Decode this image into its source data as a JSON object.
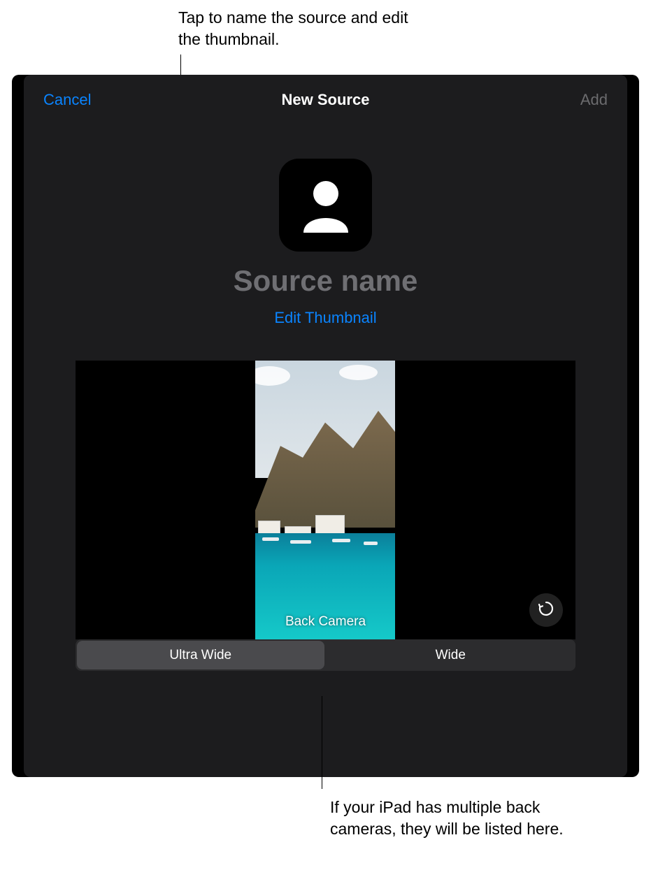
{
  "callouts": {
    "top": "Tap to name the source and edit the thumbnail.",
    "bottom": "If your iPad has multiple back cameras, they will be listed here."
  },
  "nav": {
    "cancel": "Cancel",
    "title": "New Source",
    "add": "Add"
  },
  "source": {
    "name_placeholder": "Source name",
    "edit_thumb": "Edit Thumbnail"
  },
  "preview": {
    "camera_label": "Back Camera",
    "flip_icon_name": "flip-camera-icon"
  },
  "segments": {
    "selected": 0,
    "items": [
      "Ultra Wide",
      "Wide"
    ]
  },
  "colors": {
    "accent": "#0a84ff",
    "bg_sheet": "#1c1c1e"
  }
}
